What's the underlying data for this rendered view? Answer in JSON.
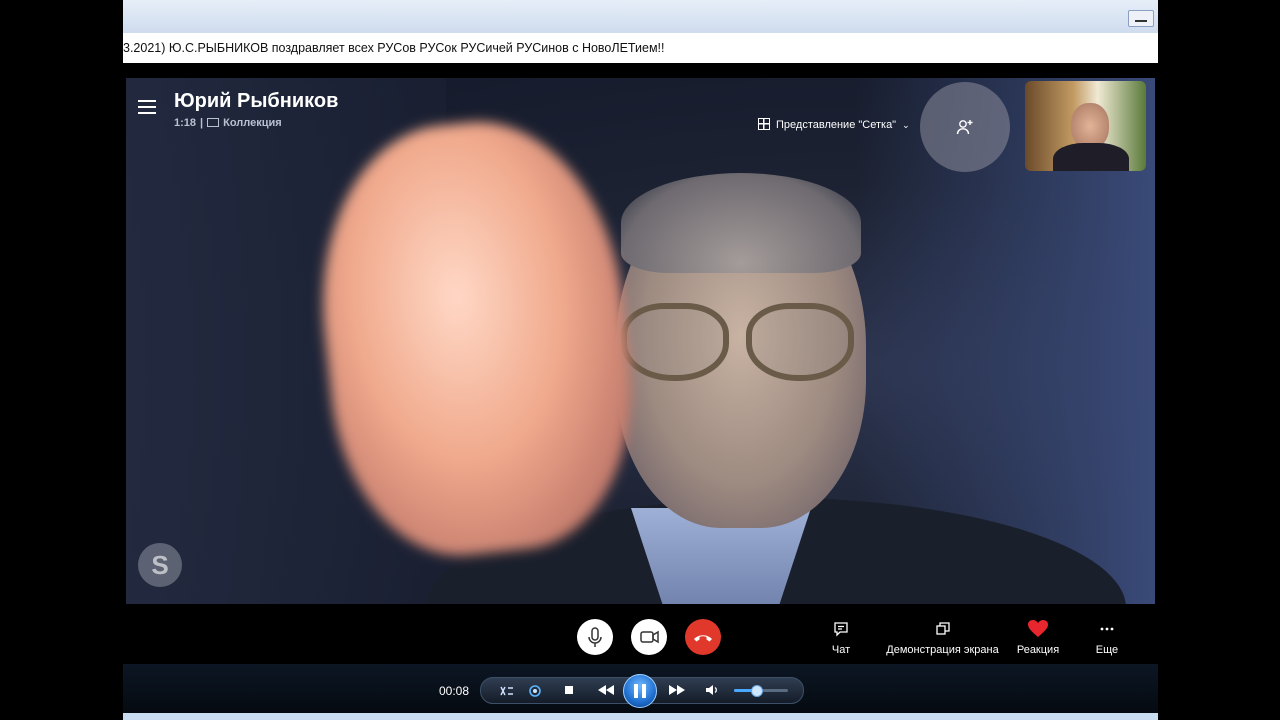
{
  "window": {
    "ticker_text": "3.2021) Ю.С.РЫБНИКОВ поздравляет всех РУСов РУСок РУСичей РУСинов с НовоЛЕТием!!"
  },
  "call": {
    "caller_name": "Юрий Рыбников",
    "duration": "1:18",
    "separator": "|",
    "collection_label": "Коллекция",
    "view_label": "Представление \"Сетка\"",
    "watermark": "S"
  },
  "controls": {
    "chat_label": "Чат",
    "share_label": "Демонстрация экрана",
    "reaction_label": "Реакция",
    "more_label": "Еще",
    "end_call_color": "#e0392b",
    "reaction_color": "#e8262d"
  },
  "player": {
    "elapsed": "00:08",
    "volume_level": 0.4
  }
}
